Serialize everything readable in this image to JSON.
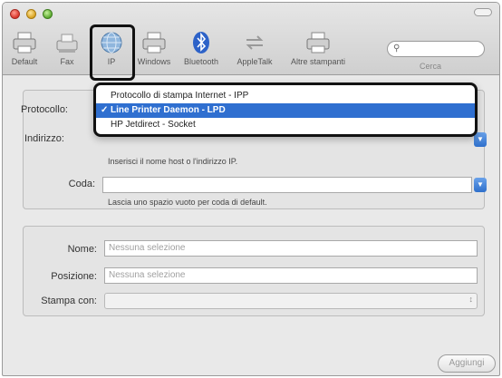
{
  "toolbar": {
    "items": [
      {
        "label": "Default",
        "icon": "printer-default-icon"
      },
      {
        "label": "Fax",
        "icon": "fax-icon"
      },
      {
        "label": "IP",
        "icon": "globe-icon"
      },
      {
        "label": "Windows",
        "icon": "windows-printer-icon"
      },
      {
        "label": "Bluetooth",
        "icon": "bluetooth-icon"
      },
      {
        "label": "AppleTalk",
        "icon": "appletalk-icon"
      },
      {
        "label": "Altre stampanti",
        "icon": "other-printers-icon"
      }
    ],
    "search_placeholder": "",
    "search_label": "Cerca"
  },
  "form": {
    "protocol_label": "Protocollo:",
    "address_label": "Indirizzo:",
    "address_hint": "Inserisci il nome host o l'indirizzo IP.",
    "queue_label": "Coda:",
    "queue_value": "",
    "queue_hint": "Lascia uno spazio vuoto per coda di default.",
    "name_label": "Nome:",
    "name_value": "Nessuna selezione",
    "location_label": "Posizione:",
    "location_value": "Nessuna selezione",
    "print_with_label": "Stampa con:",
    "add_button": "Aggiungi"
  },
  "protocol_menu": {
    "items": [
      {
        "label": "Protocollo di stampa Internet - IPP",
        "selected": false
      },
      {
        "label": "Line Printer Daemon - LPD",
        "selected": true
      },
      {
        "label": "HP Jetdirect - Socket",
        "selected": false
      }
    ],
    "check_glyph": "✓"
  },
  "colors": {
    "selection": "#2f6fd0",
    "window_bg": "#e9e9e9"
  }
}
